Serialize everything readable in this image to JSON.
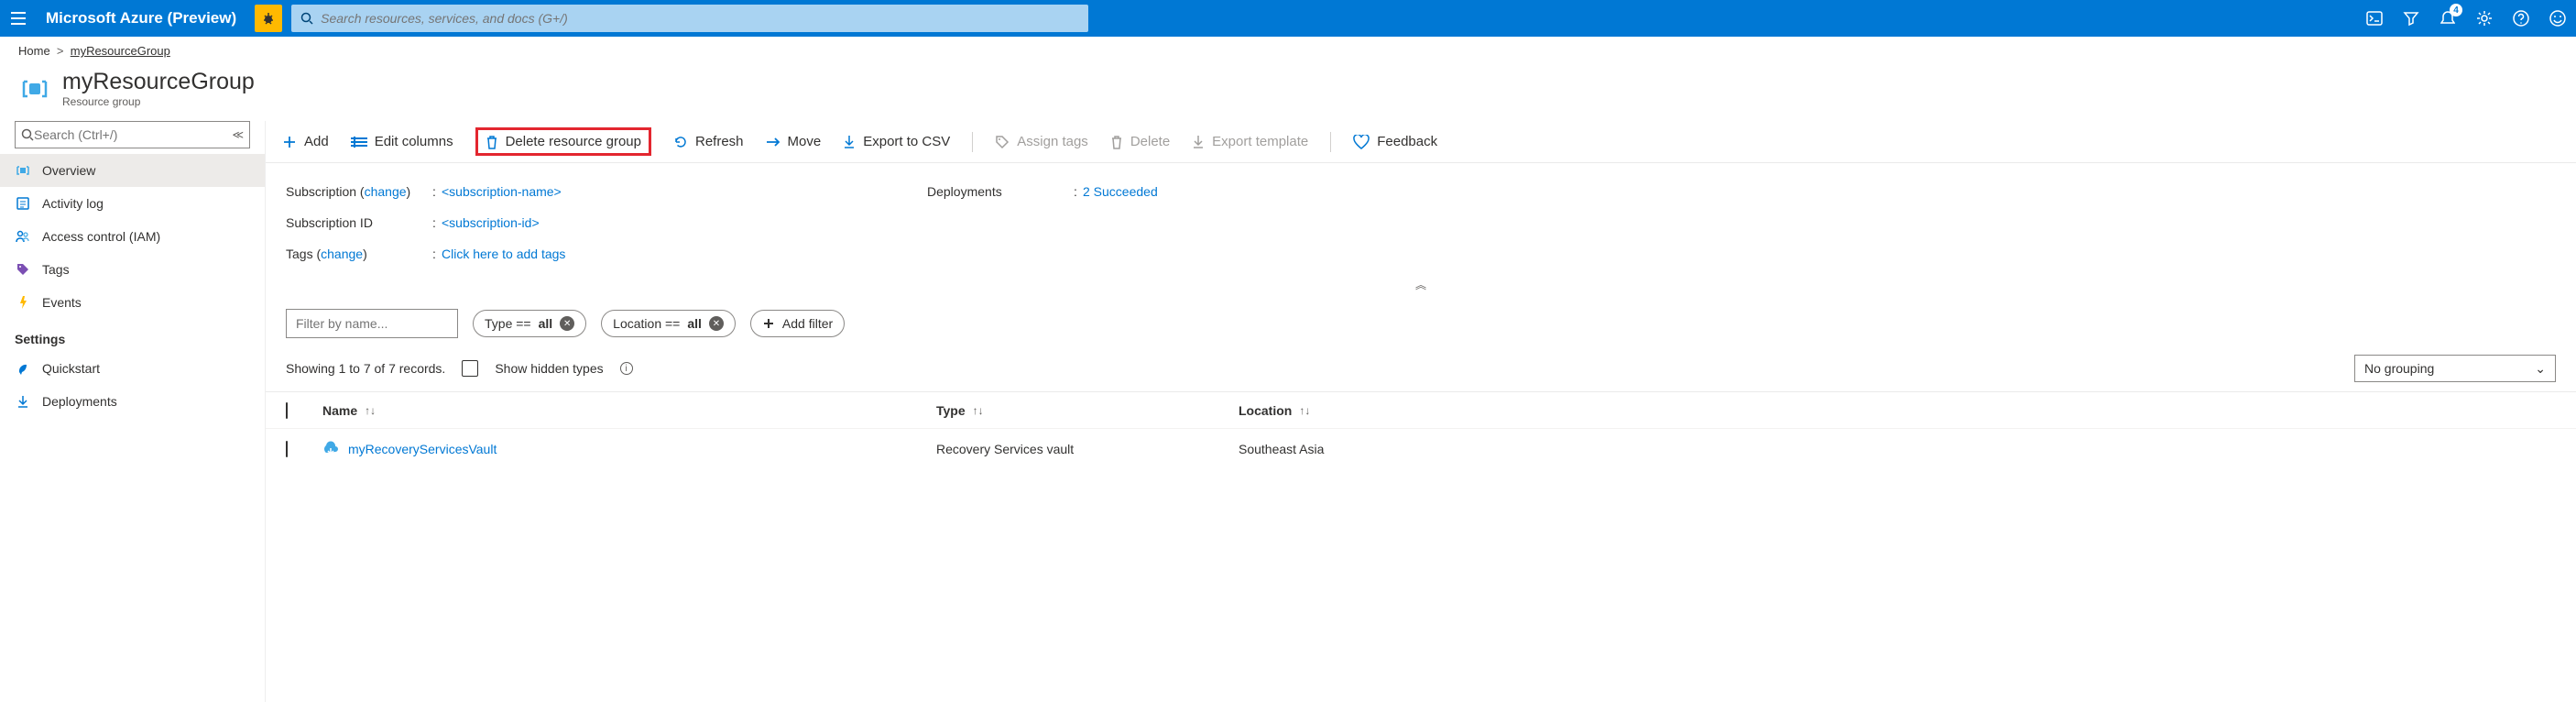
{
  "header": {
    "brand": "Microsoft Azure (Preview)",
    "search_placeholder": "Search resources, services, and docs (G+/)",
    "notification_count": "4"
  },
  "breadcrumb": {
    "home": "Home",
    "current": "myResourceGroup"
  },
  "page": {
    "title": "myResourceGroup",
    "subtitle": "Resource group"
  },
  "sidebar": {
    "search_placeholder": "Search (Ctrl+/)",
    "items": {
      "overview": "Overview",
      "activity": "Activity log",
      "access": "Access control (IAM)",
      "tags": "Tags",
      "events": "Events"
    },
    "settings_header": "Settings",
    "settings": {
      "quickstart": "Quickstart",
      "deployments": "Deployments"
    }
  },
  "toolbar": {
    "add": "Add",
    "edit_columns": "Edit columns",
    "delete_rg": "Delete resource group",
    "refresh": "Refresh",
    "move": "Move",
    "export_csv": "Export to CSV",
    "assign_tags": "Assign tags",
    "delete": "Delete",
    "export_template": "Export template",
    "feedback": "Feedback"
  },
  "props": {
    "subscription_label": "Subscription",
    "change": "change",
    "subscription_value": "<subscription-name>",
    "subscription_id_label": "Subscription ID",
    "subscription_id_value": "<subscription-id>",
    "tags_label": "Tags",
    "tags_value": "Click here to add tags",
    "deployments_label": "Deployments",
    "deployments_value": "2 Succeeded"
  },
  "filters": {
    "filter_placeholder": "Filter by name...",
    "type_label": "Type ==",
    "type_value": "all",
    "location_label": "Location ==",
    "location_value": "all",
    "add_filter": "Add filter"
  },
  "records": {
    "summary": "Showing 1 to 7 of 7 records.",
    "show_hidden": "Show hidden types",
    "grouping": "No grouping"
  },
  "table": {
    "col_name": "Name",
    "col_type": "Type",
    "col_location": "Location",
    "rows": [
      {
        "name": "myRecoveryServicesVault",
        "type": "Recovery Services vault",
        "location": "Southeast Asia"
      }
    ]
  }
}
